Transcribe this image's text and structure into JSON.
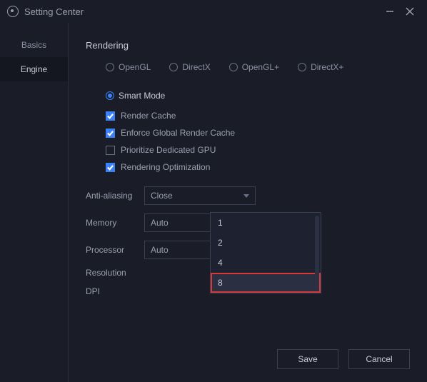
{
  "titlebar": {
    "title": "Setting Center"
  },
  "sidebar": {
    "items": [
      {
        "label": "Basics"
      },
      {
        "label": "Engine"
      }
    ],
    "active_index": 1
  },
  "rendering": {
    "heading": "Rendering",
    "modes": [
      {
        "label": "OpenGL",
        "selected": false
      },
      {
        "label": "DirectX",
        "selected": false
      },
      {
        "label": "OpenGL+",
        "selected": false
      },
      {
        "label": "DirectX+",
        "selected": false
      },
      {
        "label": "Smart Mode",
        "selected": true
      }
    ],
    "checks": [
      {
        "label": "Render Cache",
        "checked": true
      },
      {
        "label": "Enforce Global Render Cache",
        "checked": true
      },
      {
        "label": "Prioritize Dedicated GPU",
        "checked": false
      },
      {
        "label": "Rendering Optimization",
        "checked": true
      }
    ]
  },
  "fields": {
    "anti_aliasing": {
      "label": "Anti-aliasing",
      "value": "Close"
    },
    "memory": {
      "label": "Memory",
      "value": "Auto"
    },
    "processor": {
      "label": "Processor",
      "value": "Auto",
      "open": true,
      "options": [
        "1",
        "2",
        "4",
        "8"
      ],
      "highlight_index": 3
    },
    "resolution": {
      "label": "Resolution"
    },
    "dpi": {
      "label": "DPI"
    }
  },
  "footer": {
    "save": "Save",
    "cancel": "Cancel"
  }
}
